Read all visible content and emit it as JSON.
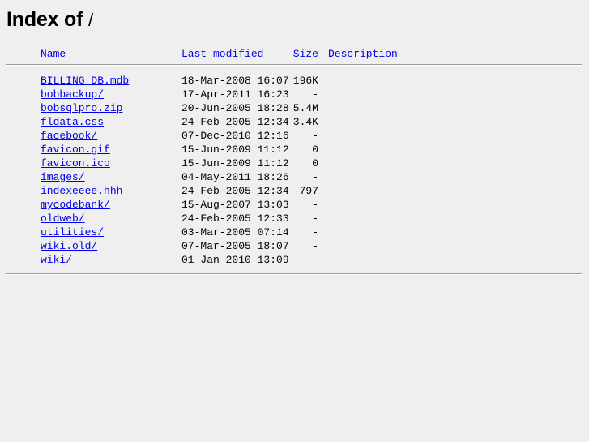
{
  "page": {
    "title_prefix": "Index of ",
    "title_path": "/"
  },
  "table": {
    "headers": {
      "name": "Name",
      "last_modified": "Last modified",
      "size": "Size",
      "description": "Description"
    },
    "rows": [
      {
        "name": "BILLING_DB.mdb",
        "last_modified": "18-Mar-2008 16:07",
        "size": "196K",
        "description": ""
      },
      {
        "name": "bobbackup/",
        "last_modified": "17-Apr-2011 16:23",
        "size": "-",
        "description": ""
      },
      {
        "name": "bobsqlpro.zip",
        "last_modified": "20-Jun-2005 18:28",
        "size": "5.4M",
        "description": ""
      },
      {
        "name": "fldata.css",
        "last_modified": "24-Feb-2005 12:34",
        "size": "3.4K",
        "description": ""
      },
      {
        "name": "facebook/",
        "last_modified": "07-Dec-2010 12:16",
        "size": "-",
        "description": ""
      },
      {
        "name": "favicon.gif",
        "last_modified": "15-Jun-2009 11:12",
        "size": "0",
        "description": ""
      },
      {
        "name": "favicon.ico",
        "last_modified": "15-Jun-2009 11:12",
        "size": "0",
        "description": ""
      },
      {
        "name": "images/",
        "last_modified": "04-May-2011 18:26",
        "size": "-",
        "description": ""
      },
      {
        "name": "indexeeee.hhh",
        "last_modified": "24-Feb-2005 12:34",
        "size": "797",
        "description": ""
      },
      {
        "name": "mycodebank/",
        "last_modified": "15-Aug-2007 13:03",
        "size": "-",
        "description": ""
      },
      {
        "name": "oldweb/",
        "last_modified": "24-Feb-2005 12:33",
        "size": "-",
        "description": ""
      },
      {
        "name": "utilities/",
        "last_modified": "03-Mar-2005 07:14",
        "size": "-",
        "description": ""
      },
      {
        "name": "wiki.old/",
        "last_modified": "07-Mar-2005 18:07",
        "size": "-",
        "description": ""
      },
      {
        "name": "wiki/",
        "last_modified": "01-Jan-2010 13:09",
        "size": "-",
        "description": ""
      }
    ]
  },
  "colors": {
    "background": "#efefef",
    "link": "#0000ee",
    "text": "#000000",
    "rule": "#9a9a9a"
  }
}
